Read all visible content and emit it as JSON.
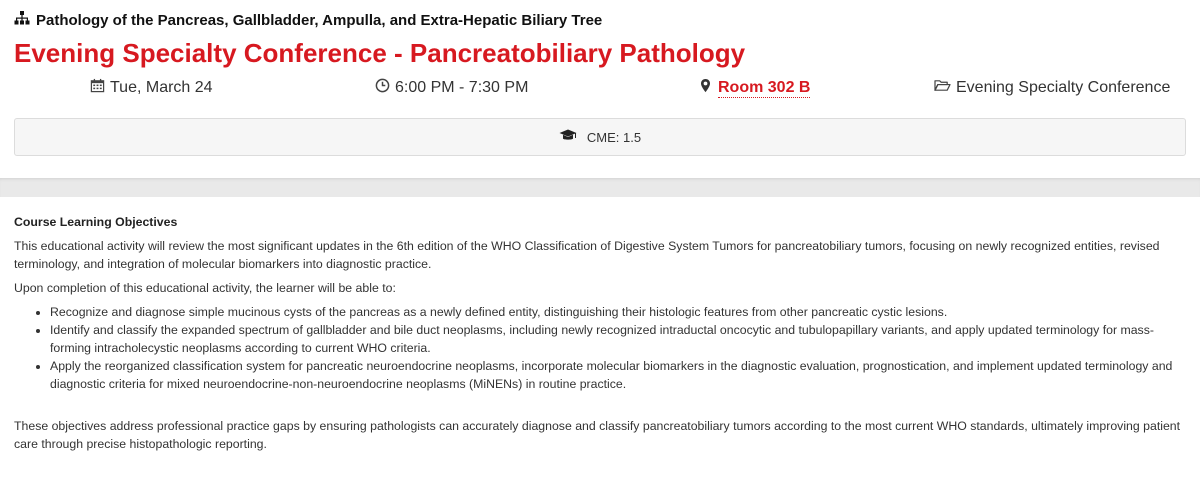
{
  "session": {
    "track_icon": "sitemap-icon",
    "track": "Pathology of the Pancreas, Gallbladder, Ampulla, and Extra-Hepatic Biliary Tree",
    "title": "Evening Specialty Conference - Pancreatobiliary Pathology",
    "date": "Tue, March 24",
    "time": "6:00 PM - 7:30 PM",
    "room": "Room 302 B",
    "category": "Evening Specialty Conference",
    "cme": "CME: 1.5",
    "accent_color": "#d71920"
  },
  "objectives": {
    "heading": "Course Learning Objectives",
    "intro": "This educational activity will review the most significant updates in the 6th edition of the WHO Classification of Digestive System Tumors for pancreatobiliary tumors, focusing on newly recognized entities, revised terminology, and integration of molecular biomarkers into diagnostic practice.",
    "lead": "Upon completion of this educational activity, the learner will be able to:",
    "items": [
      "Recognize and diagnose simple mucinous cysts of the pancreas as a newly defined entity, distinguishing their histologic features from other pancreatic cystic lesions.",
      "Identify and classify the expanded spectrum of gallbladder and bile duct neoplasms, including newly recognized intraductal oncocytic and tubulopapillary variants, and apply updated terminology for mass-forming intracholecystic neoplasms according to current WHO criteria.",
      "Apply the reorganized classification system for pancreatic neuroendocrine neoplasms, incorporate molecular biomarkers in the diagnostic evaluation, prognostication, and implement updated terminology and diagnostic criteria for mixed neuroendocrine-non-neuroendocrine neoplasms (MiNENs) in routine practice."
    ],
    "closing": "These objectives address professional practice gaps by ensuring pathologists can accurately diagnose and classify pancreatobiliary tumors according to the most current WHO standards, ultimately improving patient care through precise histopathologic reporting."
  }
}
